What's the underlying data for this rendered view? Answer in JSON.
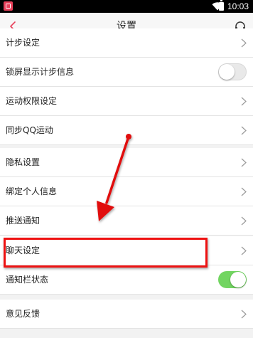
{
  "status_bar": {
    "time": "10:03",
    "app_icon": "app-badge-icon",
    "wifi_icon": "wifi-icon",
    "battery_icon": "battery-icon"
  },
  "header": {
    "title": "设置",
    "back_icon": "back-chevron-icon",
    "support_icon": "headset-icon",
    "accent_color": "#e8405a"
  },
  "settings": {
    "items": [
      {
        "label": "计步设定",
        "control": "chevron"
      },
      {
        "label": "锁屏显示计步信息",
        "control": "toggle",
        "on": false
      },
      {
        "label": "运动权限设定",
        "control": "chevron"
      },
      {
        "label": "同步QQ运动",
        "control": "chevron"
      },
      {
        "label": "隐私设置",
        "control": "chevron"
      },
      {
        "label": "绑定个人信息",
        "control": "chevron"
      },
      {
        "label": "推送通知",
        "control": "chevron"
      },
      {
        "label": "聊天设定",
        "control": "chevron"
      },
      {
        "label": "通知栏状态",
        "control": "toggle",
        "on": true
      },
      {
        "label": "意见反馈",
        "control": "chevron"
      }
    ]
  },
  "annotation": {
    "color": "#e11111",
    "arrow_icon": "red-arrow-annotation",
    "highlighted_item": "聊天设定"
  },
  "colors": {
    "toggle_on": "#72d561",
    "toggle_off": "#e9e9e9",
    "background": "#f2f2f2"
  }
}
